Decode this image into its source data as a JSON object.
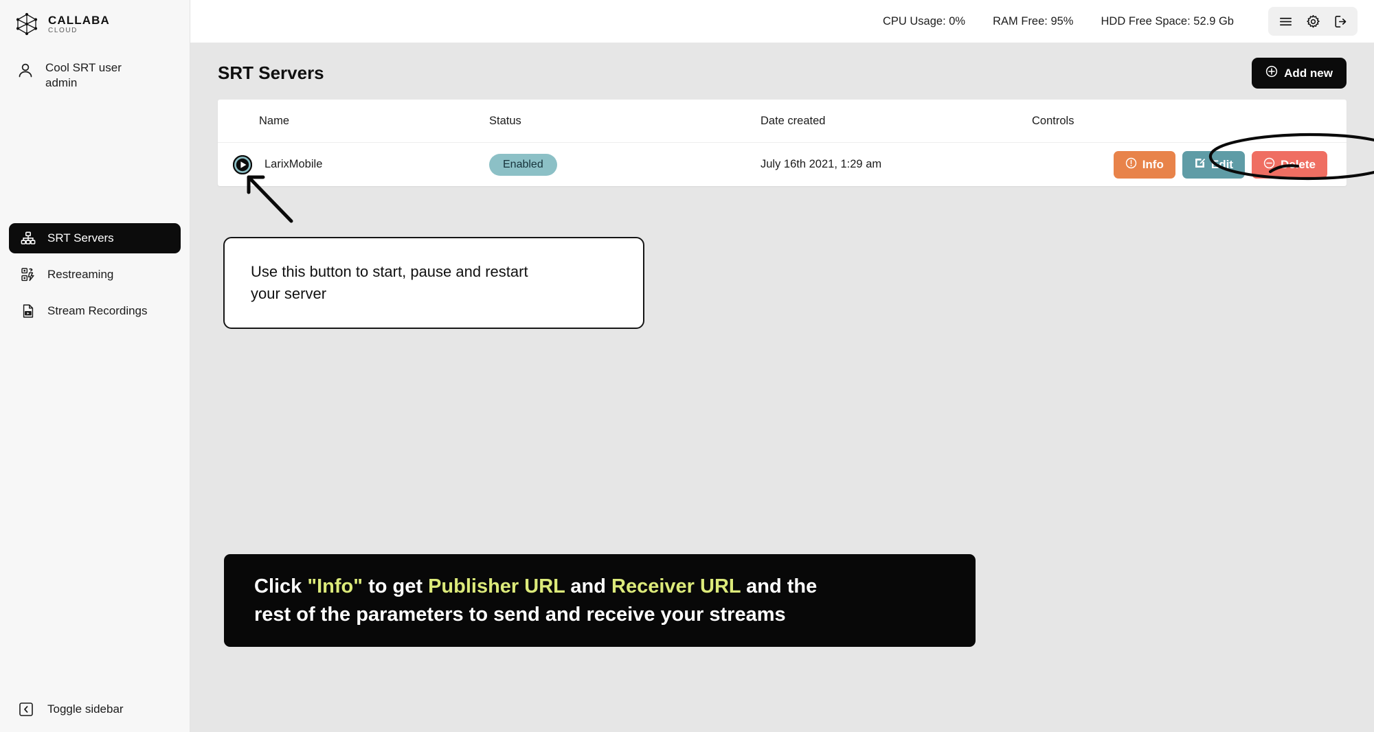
{
  "brand": {
    "name": "CALLABA",
    "sub": "CLOUD",
    "logo_icon": "network-nodes-icon"
  },
  "user": {
    "icon": "user-icon",
    "line1": "Cool SRT user",
    "line2": "admin"
  },
  "sidebar": {
    "items": [
      {
        "label": "SRT Servers",
        "icon": "sitemap-icon",
        "active": true
      },
      {
        "label": "Restreaming",
        "icon": "restream-icon",
        "active": false
      },
      {
        "label": "Stream Recordings",
        "icon": "file-video-icon",
        "active": false
      }
    ],
    "toggle": {
      "label": "Toggle sidebar",
      "icon": "chevron-left-square-icon"
    }
  },
  "topbar": {
    "stats": [
      {
        "label": "CPU Usage: 0%"
      },
      {
        "label": "RAM Free: 95%"
      },
      {
        "label": "HDD Free Space: 52.9 Gb"
      }
    ],
    "icons": [
      {
        "name": "hamburger-menu-icon"
      },
      {
        "name": "gear-icon"
      },
      {
        "name": "logout-icon"
      }
    ]
  },
  "page": {
    "title": "SRT Servers",
    "add_new_label": "Add new",
    "add_new_icon": "plus-circle-icon"
  },
  "table": {
    "columns": [
      "Name",
      "Status",
      "Date created",
      "Controls"
    ],
    "rows": [
      {
        "play_icon": "play-circle-icon",
        "name": "LarixMobile",
        "status": "Enabled",
        "date": "July 16th 2021, 1:29 am",
        "controls": [
          {
            "label": "Info",
            "icon": "info-circle-icon",
            "color": "#e8834a"
          },
          {
            "label": "Edit",
            "icon": "pencil-square-icon",
            "color": "#5f9ca6"
          },
          {
            "label": "Delete",
            "icon": "minus-circle-icon",
            "color": "#ef6e62"
          }
        ]
      }
    ]
  },
  "annotations": {
    "arrow": {
      "name": "pointer-arrow",
      "target": "play-button"
    },
    "ellipse": {
      "name": "highlight-ellipse",
      "target": "info-button"
    },
    "callout": {
      "line1": "Use this button to start, pause and restart",
      "line2": "your server"
    },
    "banner": {
      "p1": "Click ",
      "q1": "\"Info\"",
      "p2": " to get ",
      "q2": "Publisher URL",
      "p3": " and ",
      "q3": "Receiver URL",
      "p4": " and the",
      "line2": "rest of the parameters to send and receive your streams",
      "highlight_color": "#dcea7a"
    }
  }
}
